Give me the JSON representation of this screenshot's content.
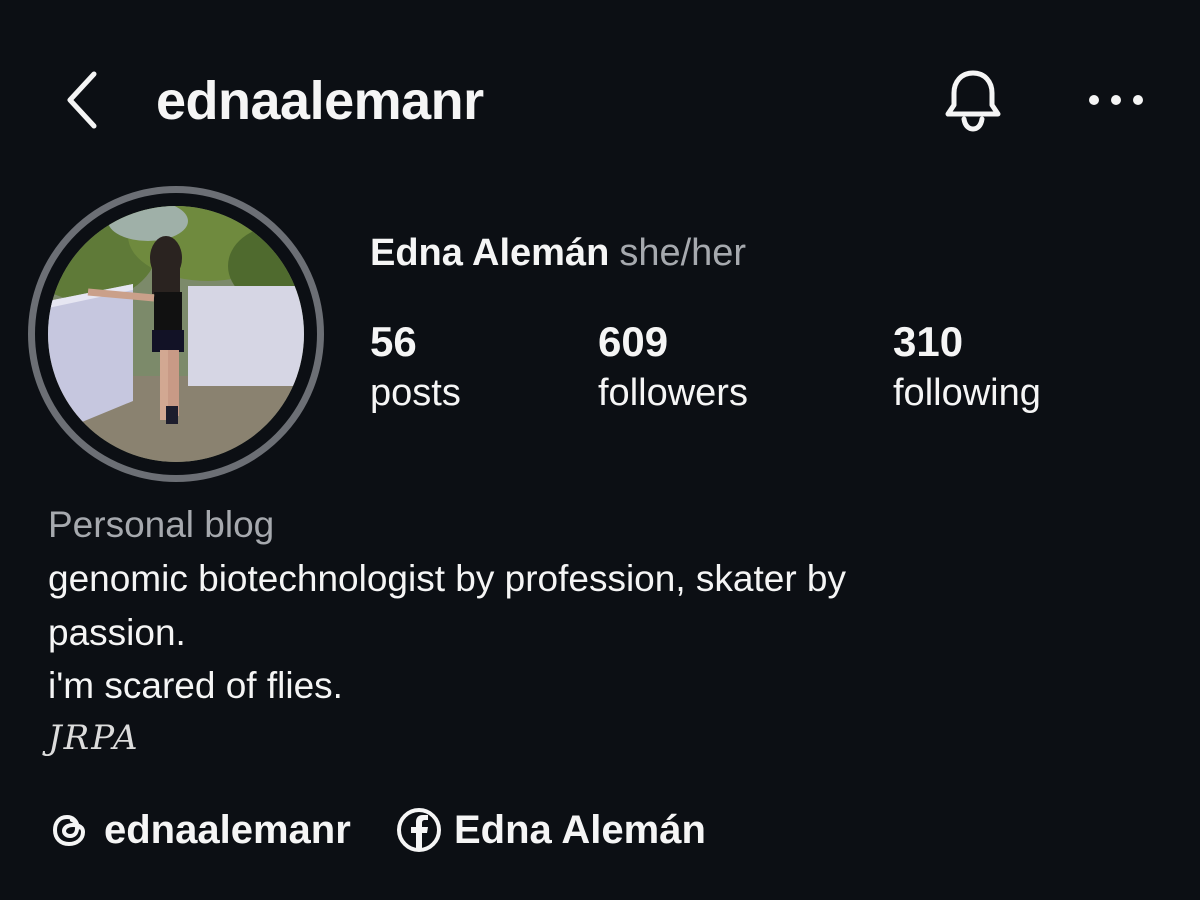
{
  "header": {
    "username": "ednaalemanr",
    "back_icon": "chevron-left-icon",
    "notification_icon": "bell-icon",
    "more_icon": "more-horizontal-icon"
  },
  "profile": {
    "full_name": "Edna Alemán",
    "pronouns": "she/her",
    "stats": [
      {
        "value": "56",
        "label": "posts"
      },
      {
        "value": "609",
        "label": "followers"
      },
      {
        "value": "310",
        "label": "following"
      }
    ]
  },
  "bio": {
    "category": "Personal blog",
    "lines": [
      "genomic biotechnologist by profession, skater by",
      "passion.",
      "i'm scared of flies."
    ],
    "signature": "JRPA"
  },
  "links": [
    {
      "icon": "threads-icon",
      "label": "ednaalemanr"
    },
    {
      "icon": "facebook-icon",
      "label": "Edna Alemán"
    }
  ],
  "colors": {
    "background": "#0c0f14",
    "text": "#f5f5f5",
    "muted_text": "#a6a9ae",
    "avatar_ring": "#6c6f75"
  }
}
